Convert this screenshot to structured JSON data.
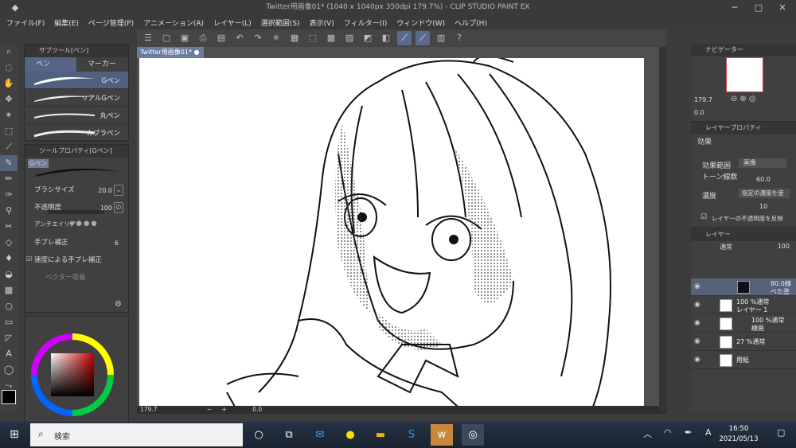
{
  "window": {
    "title": "Twitter用画像01* (1040 x 1040px 350dpi 179.7%) - CLIP STUDIO PAINT EX"
  },
  "menu": [
    "ファイル(F)",
    "編集(E)",
    "ページ管理(P)",
    "アニメーション(A)",
    "レイヤー(L)",
    "選択範囲(S)",
    "表示(V)",
    "フィルター(I)",
    "ウィンドウ(W)",
    "ヘルプ(H)"
  ],
  "subtool": {
    "header": "サブツール[ペン]",
    "tab_pen": "ペン",
    "tab_marker": "マーカー",
    "brushes": [
      "Gペン",
      "リアルGペン",
      "丸ペン",
      "カブラペン"
    ],
    "selected_index": 0
  },
  "toolprop": {
    "header": "ツールプロパティ[Gペン]",
    "preview_label": "Gペン",
    "brush_size_label": "ブラシサイズ",
    "brush_size": "20.0",
    "opacity_label": "不透明度",
    "opacity": "100",
    "antialias_label": "アンチエイリア",
    "stabilization_label": "手ブレ補正",
    "stabilization": "6",
    "speed_stab_label": "速度による手ブレ補正",
    "vector_label": "ベクター吸着"
  },
  "document": {
    "tab": "Twitter用画像01*",
    "zoom": "179.7",
    "angle": "0.0"
  },
  "navigator": {
    "header": "ナビゲーター",
    "zoom": "179.7",
    "angle": "0.0"
  },
  "layer_property": {
    "header": "レイヤープロパティ",
    "effect_label": "効果",
    "range_label": "効果範囲",
    "range_value": "画像",
    "tone_lines_label": "トーン線数",
    "tone_lines": "60.0",
    "density_label": "濃度",
    "density_value": "指定の濃度を使",
    "density_num": "10",
    "opacity_check": "レイヤーの不透明度を反映"
  },
  "layers": {
    "header": "レイヤー",
    "blend": "通常",
    "opacity": "100",
    "items": [
      {
        "line1": "80.0線",
        "line2": "ベた塗",
        "selected": true
      },
      {
        "line1": "100 %通常",
        "line2": "レイヤー 1",
        "selected": false
      },
      {
        "line1": "100 %通常",
        "line2": "線画",
        "selected": false
      },
      {
        "line1": "27 %通常",
        "line2": "",
        "selected": false
      },
      {
        "line1": "用紙",
        "line2": "",
        "selected": false
      }
    ]
  },
  "taskbar": {
    "search_placeholder": "検索",
    "time": "16:50",
    "date": "2021/05/13",
    "ime": "A"
  },
  "colors": {
    "accent": "#566485",
    "taskbar": "#1e2a3a"
  }
}
